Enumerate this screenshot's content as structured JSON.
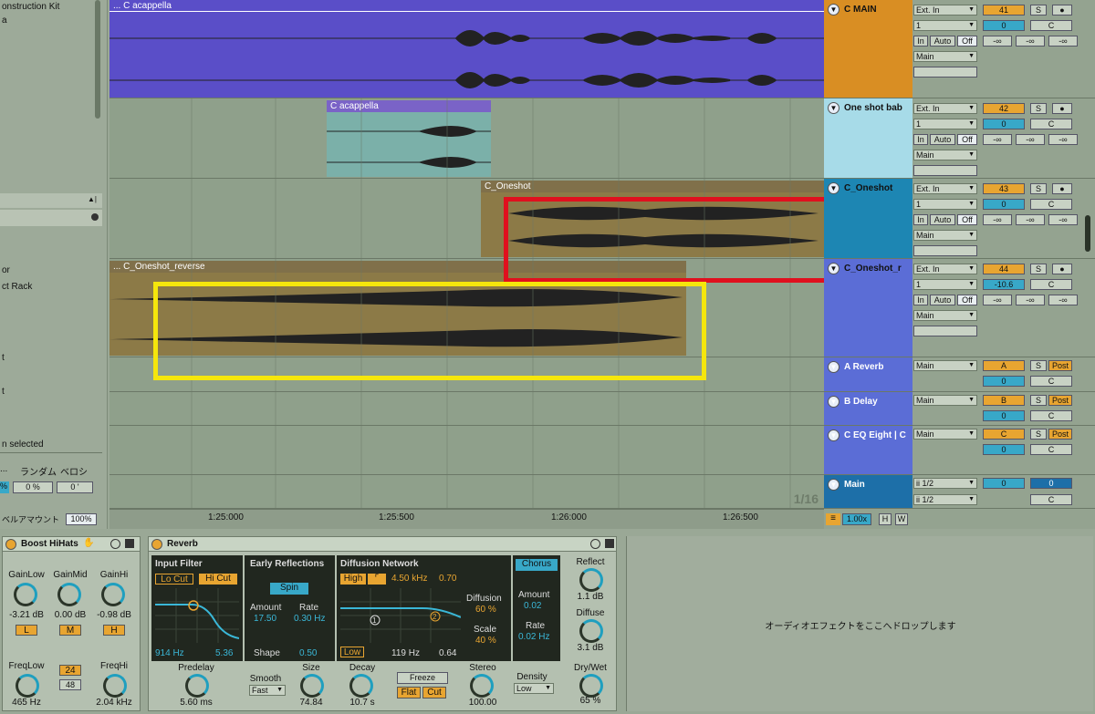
{
  "browser": {
    "top_item": "onstruction Kit",
    "item2": "a",
    "item_or": "or",
    "item_rack": "ct Rack",
    "item_t": "t",
    "item_t2": "t",
    "status": "n selected",
    "col_random": "ランダム",
    "col_velocity": "ベロシ",
    "val_pct": "%",
    "val_0": "0 %",
    "val_0b": "0 '",
    "param_label": "ベルアマウント",
    "param_value": "100%"
  },
  "clips": {
    "acappella_main": "... C acappella",
    "acappella_small": "C acappella",
    "oneshot": "C_Oneshot",
    "oneshot_reverse": "... C_Oneshot_reverse"
  },
  "ruler": {
    "ticks": [
      "1:25:000",
      "1:25:500",
      "1:26:000",
      "1:26:500"
    ],
    "quantize": "1/16",
    "zoom": "1.00x",
    "h": "H",
    "w": "W"
  },
  "tracks": [
    {
      "name": "C MAIN",
      "color": "#d98e23",
      "input": "Ext. In",
      "channel": "1",
      "monitor": [
        "In",
        "Auto",
        "Off"
      ],
      "output": "Main",
      "number": "41",
      "vol": "0",
      "pan": "C",
      "sends": [
        "-∞",
        "-∞",
        "-∞"
      ]
    },
    {
      "name": "One shot bab",
      "color": "#a7dbe8",
      "input": "Ext. In",
      "channel": "1",
      "monitor": [
        "In",
        "Auto",
        "Off"
      ],
      "output": "Main",
      "number": "42",
      "vol": "0",
      "pan": "C",
      "sends": [
        "-∞",
        "-∞",
        "-∞"
      ]
    },
    {
      "name": "C_Oneshot",
      "color": "#1d86b3",
      "input": "Ext. In",
      "channel": "1",
      "monitor": [
        "In",
        "Auto",
        "Off"
      ],
      "output": "Main",
      "number": "43",
      "vol": "0",
      "pan": "C",
      "sends": [
        "-∞",
        "-∞",
        "-∞"
      ]
    },
    {
      "name": "C_Oneshot_r",
      "color": "#5b6dd6",
      "input": "Ext. In",
      "channel": "1",
      "monitor": [
        "In",
        "Auto",
        "Off"
      ],
      "output": "Main",
      "number": "44",
      "vol": "-10.6",
      "pan": "C",
      "sends": [
        "-∞",
        "-∞",
        "-∞"
      ]
    }
  ],
  "returns": [
    {
      "name": "A Reverb",
      "output": "Main",
      "letter": "A",
      "s": "S",
      "post": "Post",
      "vol": "0",
      "pan": "C"
    },
    {
      "name": "B Delay",
      "output": "Main",
      "letter": "B",
      "s": "S",
      "post": "Post",
      "vol": "0",
      "pan": "C"
    },
    {
      "name": "C EQ Eight | C",
      "output": "Main",
      "letter": "C",
      "s": "S",
      "post": "Post",
      "vol": "0",
      "pan": "C"
    }
  ],
  "master": {
    "name": "Main",
    "out1": "ii 1/2",
    "out2": "ii 1/2",
    "vol": "0",
    "vol2": "0",
    "pan": "C"
  },
  "solo": "S",
  "boost": {
    "title": "Boost HiHats",
    "gain_low_label": "GainLow",
    "gain_low": "-3.21 dB",
    "gain_mid_label": "GainMid",
    "gain_mid": "0.00 dB",
    "gain_hi_label": "GainHi",
    "gain_hi": "-0.98 dB",
    "l": "L",
    "m": "M",
    "h": "H",
    "freq_low_label": "FreqLow",
    "freq_low": "465 Hz",
    "slope1": "24",
    "slope2": "48",
    "freq_hi_label": "FreqHi",
    "freq_hi": "2.04 kHz"
  },
  "reverb": {
    "title": "Reverb",
    "input_filter": "Input Filter",
    "lo_cut": "Lo Cut",
    "hi_cut": "Hi Cut",
    "filter_freq": "914 Hz",
    "filter_width": "5.36",
    "early": "Early Reflections",
    "spin": "Spin",
    "amount_label": "Amount",
    "amount": "17.50",
    "rate_label": "Rate",
    "rate": "0.30 Hz",
    "shape_label": "Shape",
    "shape": "0.50",
    "diffusion_net": "Diffusion Network",
    "high": "High",
    "high_freq": "4.50 kHz",
    "high_val": "0.70",
    "diffusion_label": "Diffusion",
    "diffusion": "60 %",
    "scale_label": "Scale",
    "scale": "40 %",
    "low": "Low",
    "low_freq": "119 Hz",
    "low_val": "0.64",
    "chorus": "Chorus",
    "ch_amount_label": "Amount",
    "ch_amount": "0.02",
    "ch_rate_label": "Rate",
    "ch_rate": "0.02 Hz",
    "reflect_label": "Reflect",
    "reflect": "1.1 dB",
    "diffuse_label": "Diffuse",
    "diffuse": "3.1 dB",
    "drywet_label": "Dry/Wet",
    "drywet": "65 %",
    "predelay_label": "Predelay",
    "predelay": "5.60 ms",
    "smooth_label": "Smooth",
    "smooth": "Fast",
    "size_label": "Size",
    "size": "74.84",
    "decay_label": "Decay",
    "decay": "10.7 s",
    "freeze": "Freeze",
    "flat": "Flat",
    "cut": "Cut",
    "stereo_label": "Stereo",
    "stereo": "100.00",
    "density_label": "Density",
    "density": "Low"
  },
  "drop_hint": "オーディオエフェクトをここへドロップします"
}
